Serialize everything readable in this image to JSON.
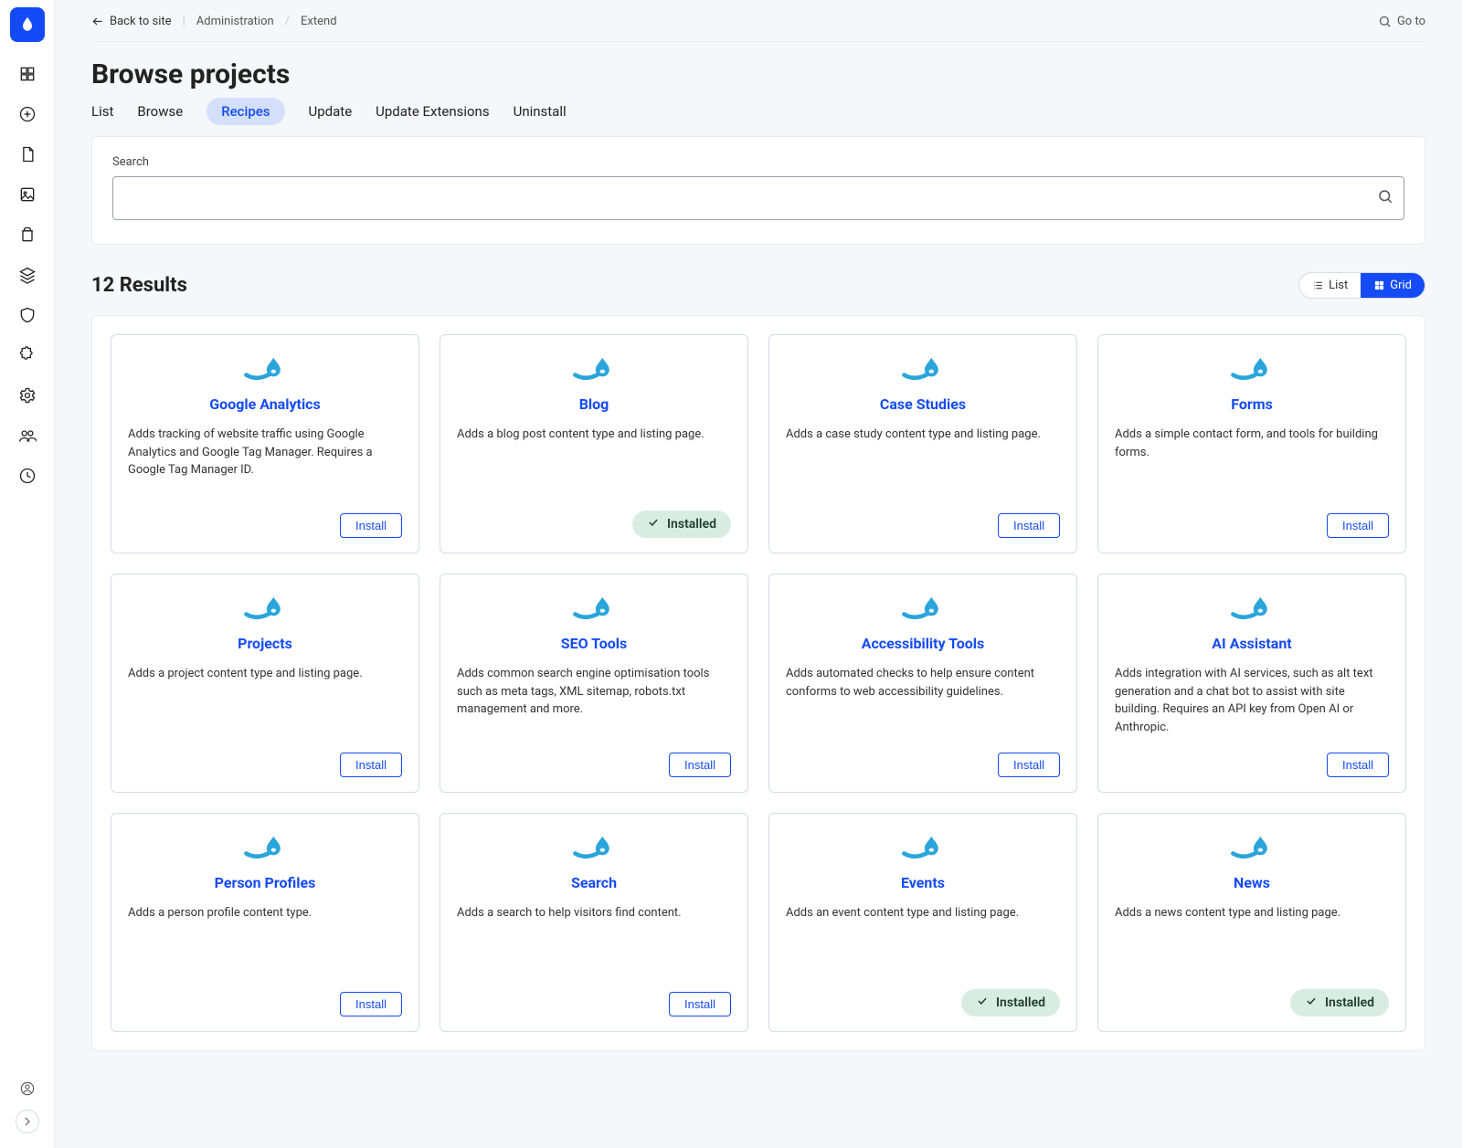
{
  "topbar": {
    "back_label": "Back to site",
    "crumbs": [
      "Administration",
      "Extend"
    ],
    "goto_label": "Go to"
  },
  "page": {
    "title": "Browse projects"
  },
  "tabs": [
    {
      "label": "List",
      "active": false
    },
    {
      "label": "Browse",
      "active": false
    },
    {
      "label": "Recipes",
      "active": true
    },
    {
      "label": "Update",
      "active": false
    },
    {
      "label": "Update Extensions",
      "active": false
    },
    {
      "label": "Uninstall",
      "active": false
    }
  ],
  "search": {
    "label": "Search",
    "value": ""
  },
  "results": {
    "count_label": "12 Results",
    "view_list_label": "List",
    "view_grid_label": "Grid",
    "install_label": "Install",
    "installed_label": "Installed"
  },
  "cards": [
    {
      "title": "Google Analytics",
      "desc": "Adds tracking of website traffic using Google Analytics and Google Tag Manager. Requires a Google Tag Manager ID.",
      "installed": false
    },
    {
      "title": "Blog",
      "desc": "Adds a blog post content type and listing page.",
      "installed": true
    },
    {
      "title": "Case Studies",
      "desc": "Adds a case study content type and listing page.",
      "installed": false
    },
    {
      "title": "Forms",
      "desc": "Adds a simple contact form, and tools for building forms.",
      "installed": false
    },
    {
      "title": "Projects",
      "desc": "Adds a project content type and listing page.",
      "installed": false
    },
    {
      "title": "SEO Tools",
      "desc": "Adds common search engine optimisation tools such as meta tags, XML sitemap, robots.txt management and more.",
      "installed": false
    },
    {
      "title": "Accessibility Tools",
      "desc": "Adds automated checks to help ensure content con­forms to web accessibility guidelines.",
      "installed": false
    },
    {
      "title": "AI Assistant",
      "desc": "Adds integration with AI services, such as alt text generation and a chat bot to assist with site building. Requires an API key from Open AI or Anthropic.",
      "installed": false
    },
    {
      "title": "Person Profiles",
      "desc": "Adds a person profile content type.",
      "installed": false
    },
    {
      "title": "Search",
      "desc": "Adds a search to help visitors find content.",
      "installed": false
    },
    {
      "title": "Events",
      "desc": "Adds an event content type and listing page.",
      "installed": true
    },
    {
      "title": "News",
      "desc": "Adds a news content type and listing page.",
      "installed": true
    }
  ],
  "sidebar_icons": [
    "dashboard-icon",
    "add-icon",
    "file-icon",
    "image-icon",
    "trash-icon",
    "layers-icon",
    "shield-icon",
    "puzzle-icon",
    "gear-icon",
    "users-icon",
    "clock-icon"
  ]
}
